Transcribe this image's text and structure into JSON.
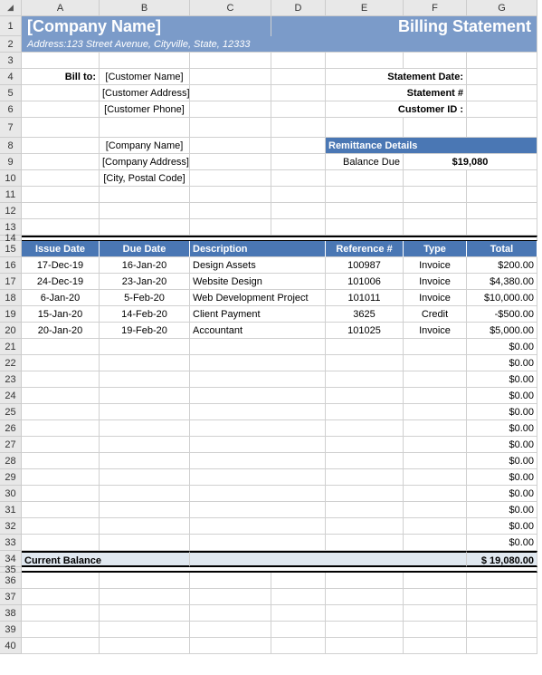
{
  "cols": [
    "A",
    "B",
    "C",
    "D",
    "E",
    "F",
    "G"
  ],
  "header": {
    "company": "[Company Name]",
    "title": "Billing Statement",
    "address_label": "Address:",
    "address": "123 Street Avenue, Cityville, State, 12333"
  },
  "billto": {
    "label": "Bill to:",
    "name": "[Customer Name]",
    "addr": "[Customer Address]",
    "phone": "[Customer Phone]"
  },
  "stmt": {
    "date_label": "Statement Date:",
    "num_label": "Statement #",
    "cust_label": "Customer ID :"
  },
  "from": {
    "name": "[Company Name]",
    "addr": "[Company Address]",
    "city": "[City, Postal Code]"
  },
  "remit": {
    "title": "Remittance Details",
    "balance_label": "Balance Due",
    "balance_value": "$19,080"
  },
  "table": {
    "headers": {
      "issue": "Issue Date",
      "due": "Due Date",
      "desc": "Description",
      "ref": "Reference #",
      "type": "Type",
      "total": "Total"
    },
    "rows": [
      {
        "issue": "17-Dec-19",
        "due": "16-Jan-20",
        "desc": "Design Assets",
        "ref": "100987",
        "type": "Invoice",
        "total": "$200.00"
      },
      {
        "issue": "24-Dec-19",
        "due": "23-Jan-20",
        "desc": "Website Design",
        "ref": "101006",
        "type": "Invoice",
        "total": "$4,380.00"
      },
      {
        "issue": "6-Jan-20",
        "due": "5-Feb-20",
        "desc": "Web Development Project",
        "ref": "101011",
        "type": "Invoice",
        "total": "$10,000.00"
      },
      {
        "issue": "15-Jan-20",
        "due": "14-Feb-20",
        "desc": "Client Payment",
        "ref": "3625",
        "type": "Credit",
        "total": "-$500.00"
      },
      {
        "issue": "20-Jan-20",
        "due": "19-Feb-20",
        "desc": "Accountant",
        "ref": "101025",
        "type": "Invoice",
        "total": "$5,000.00"
      }
    ],
    "empty_total": "$0.00",
    "empty_count": 13
  },
  "balance": {
    "label": "Current Balance",
    "value": "$  19,080.00"
  },
  "tail_rows": [
    35,
    36,
    37,
    38,
    39,
    40
  ]
}
